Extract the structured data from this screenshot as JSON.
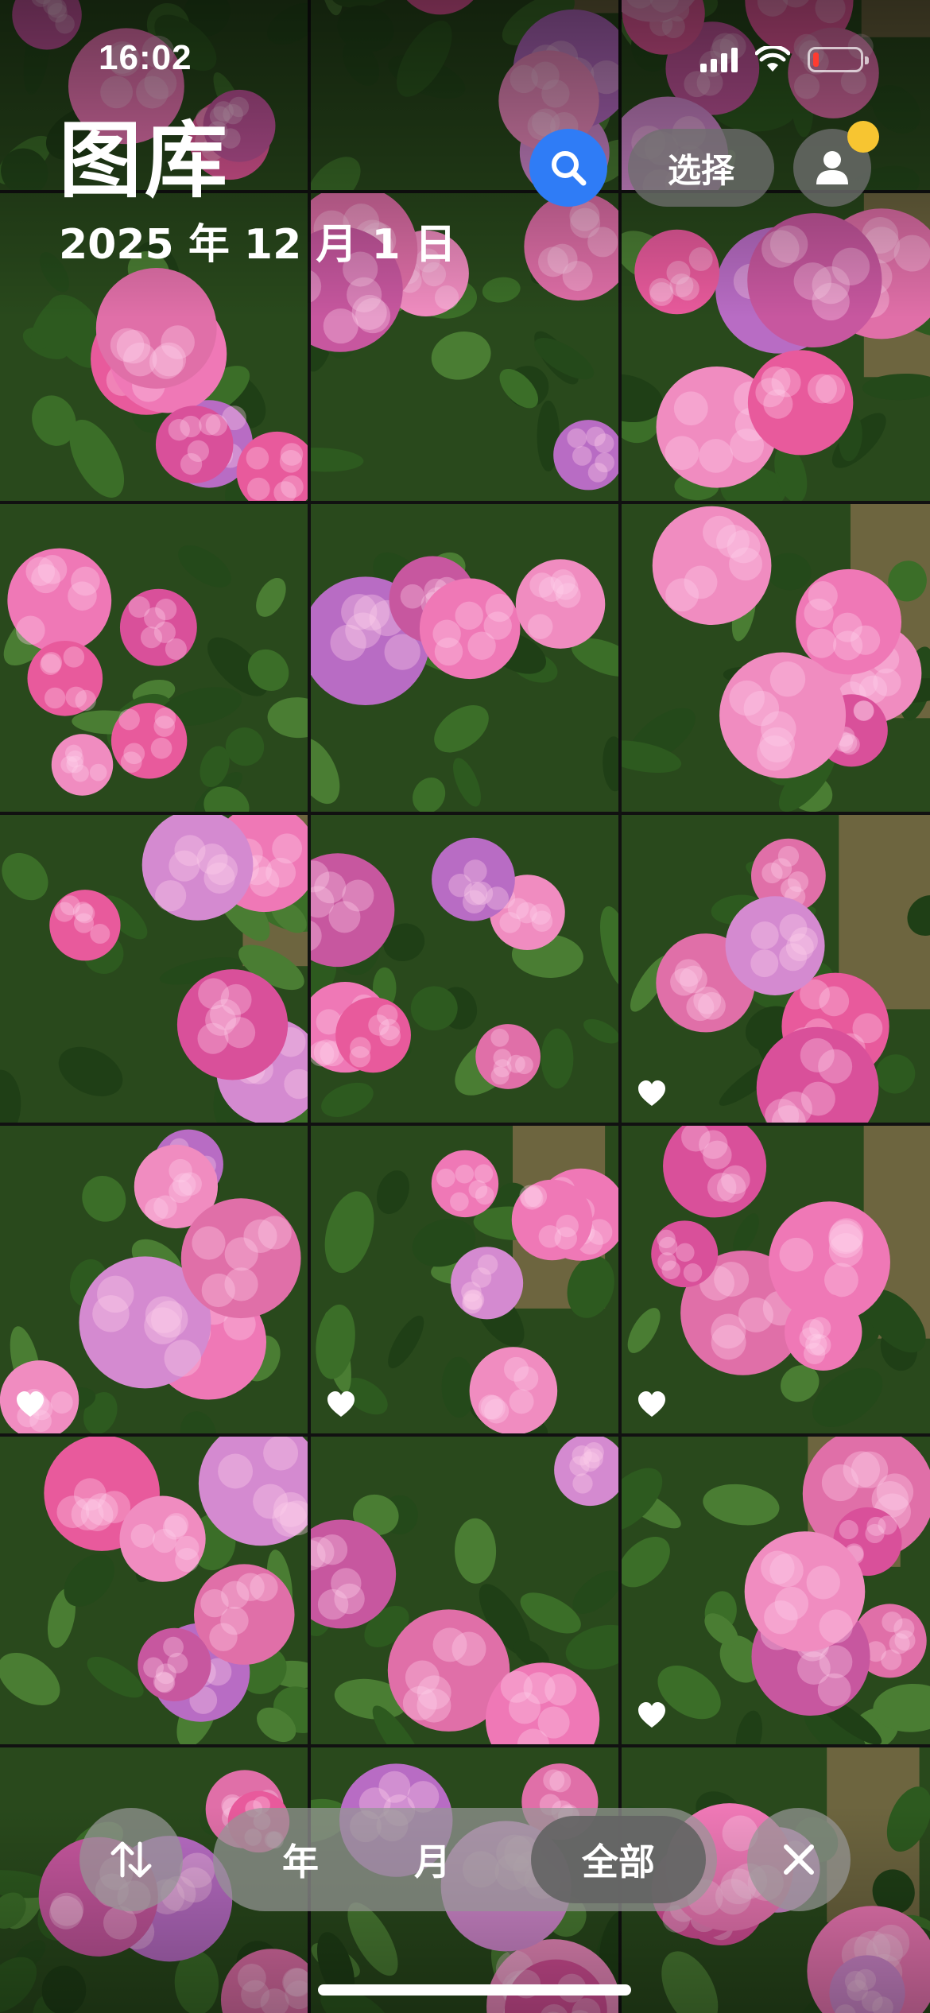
{
  "status_bar": {
    "time": "16:02",
    "battery_level": 0.12,
    "battery_color": "#ff3b30"
  },
  "header": {
    "title": "图库",
    "date": "2025 年 12 月 1 日",
    "select_label": "选择",
    "search_icon": "search-icon",
    "account_icon": "person-icon",
    "accent_color": "#2f7cf6",
    "badge_color": "#f7c531"
  },
  "photos": [
    {
      "favorite": false
    },
    {
      "favorite": false
    },
    {
      "favorite": false
    },
    {
      "favorite": false
    },
    {
      "favorite": false
    },
    {
      "favorite": false
    },
    {
      "favorite": false
    },
    {
      "favorite": false
    },
    {
      "favorite": false
    },
    {
      "favorite": false
    },
    {
      "favorite": false
    },
    {
      "favorite": true
    },
    {
      "favorite": true
    },
    {
      "favorite": true
    },
    {
      "favorite": true
    },
    {
      "favorite": false
    },
    {
      "favorite": false
    },
    {
      "favorite": true
    },
    {
      "favorite": false
    },
    {
      "favorite": false
    },
    {
      "favorite": false
    }
  ],
  "bottom_bar": {
    "sort_icon": "sort-arrows-icon",
    "segments": {
      "year": "年",
      "month": "月",
      "all": "全部"
    },
    "selected_segment": "all",
    "close_icon": "close-icon"
  }
}
